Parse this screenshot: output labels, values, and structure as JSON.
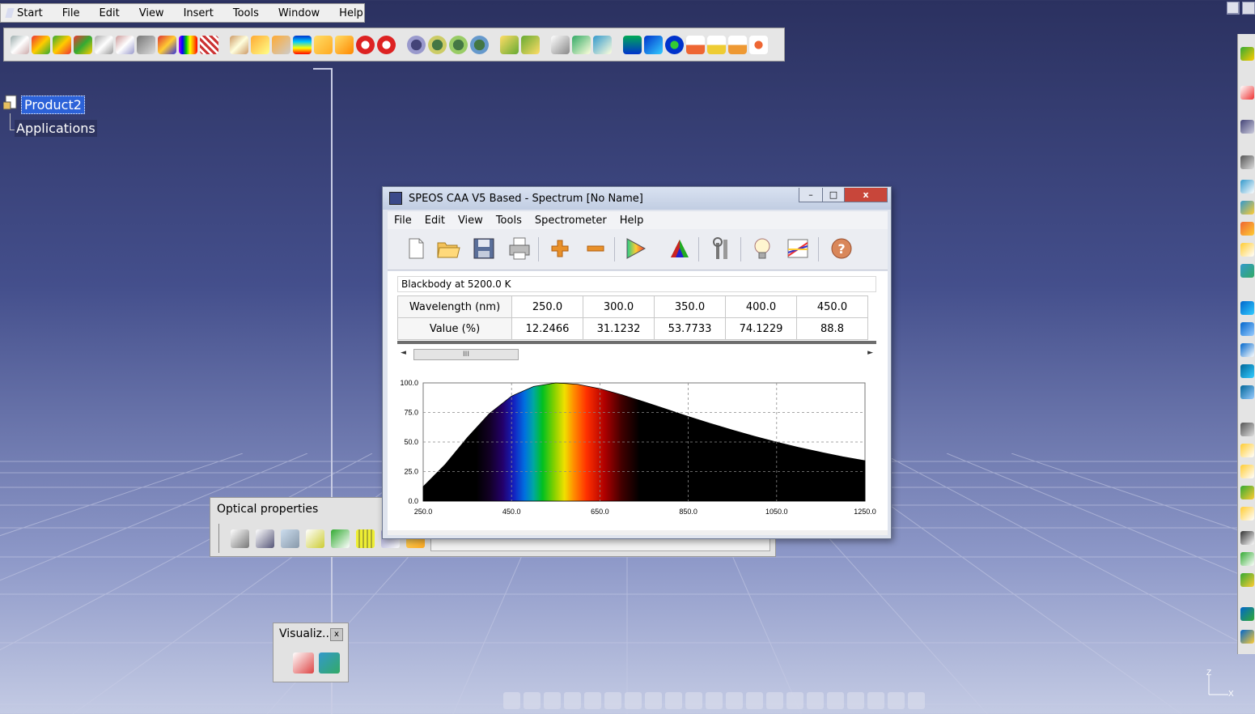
{
  "menubar": {
    "items": [
      "Start",
      "File",
      "Edit",
      "View",
      "Insert",
      "Tools",
      "Window",
      "Help"
    ]
  },
  "tree": {
    "root_label": "Product2",
    "child_label": "Applications"
  },
  "spectrum_window": {
    "title": "SPEOS CAA V5 Based - Spectrum [No Name]",
    "close_glyph": "x",
    "menu": [
      "File",
      "Edit",
      "View",
      "Tools",
      "Spectrometer",
      "Help"
    ],
    "toolbar": [
      {
        "name": "new-icon"
      },
      {
        "name": "open-icon"
      },
      {
        "name": "save-icon"
      },
      {
        "name": "print-icon"
      },
      {
        "name": "add-icon"
      },
      {
        "name": "remove-icon"
      },
      {
        "name": "color-triangle-icon"
      },
      {
        "name": "rgb-triangle-icon"
      },
      {
        "name": "settings-tool-icon"
      },
      {
        "name": "lamp-icon"
      },
      {
        "name": "spectrum-chart-icon"
      },
      {
        "name": "help-icon"
      }
    ],
    "name_field": "Blackbody at 5200.0 K",
    "table": {
      "row_headers": [
        "Wavelength (nm)",
        "Value (%)"
      ],
      "wavelengths": [
        "250.0",
        "300.0",
        "350.0",
        "400.0",
        "450.0"
      ],
      "values": [
        "12.2466",
        "31.1232",
        "53.7733",
        "74.1229",
        "88.8"
      ]
    },
    "scroll_thumb_glyph": "III"
  },
  "chart_data": {
    "type": "area",
    "title": "",
    "xlabel": "",
    "ylabel": "",
    "xlim": [
      250,
      1250
    ],
    "ylim": [
      0,
      100
    ],
    "x_ticks": [
      "250.0",
      "450.0",
      "650.0",
      "850.0",
      "1050.0",
      "1250.0"
    ],
    "y_ticks": [
      "100.0",
      "75.0",
      "50.0",
      "25.0",
      "0.0"
    ],
    "grid": true,
    "series": [
      {
        "x": [
          250,
          300,
          350,
          400,
          450,
          500,
          550,
          600,
          650,
          700,
          750,
          800,
          850,
          900,
          950,
          1000,
          1050,
          1100,
          1150,
          1200,
          1250
        ],
        "values": [
          12.2,
          31.1,
          53.8,
          74.1,
          88.8,
          97.0,
          100.0,
          98.8,
          95.1,
          89.9,
          84.0,
          77.8,
          71.6,
          65.7,
          60.1,
          54.8,
          49.9,
          45.4,
          41.3,
          37.5,
          34.2
        ]
      }
    ]
  },
  "optical_panel": {
    "title": "Optical properties",
    "field_text": ""
  },
  "visualiz_panel": {
    "title": "Visualiz...",
    "close_glyph": "x"
  },
  "axes_indicator": {
    "z": "Z",
    "x": "X"
  },
  "colors": {
    "selection": "#2c62d8",
    "window_title": "#c1cde2",
    "close_red": "#c8463a"
  }
}
